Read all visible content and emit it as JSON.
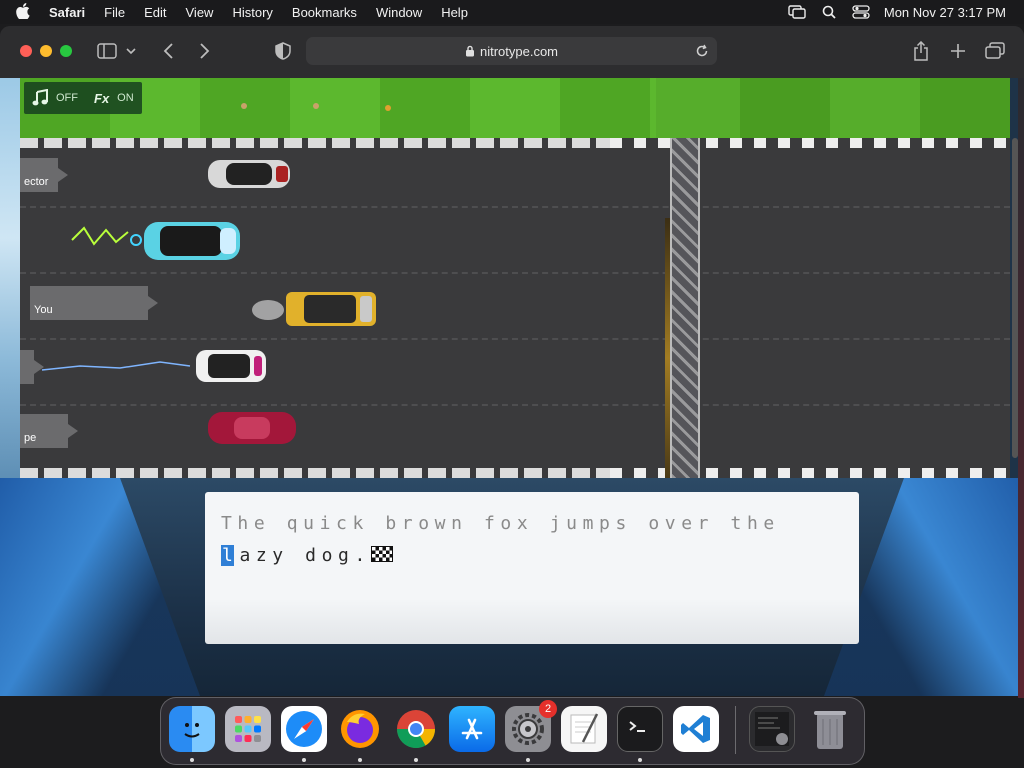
{
  "menubar": {
    "app": "Safari",
    "items": [
      "File",
      "Edit",
      "View",
      "History",
      "Bookmarks",
      "Window",
      "Help"
    ],
    "clock": "Mon Nov 27  3:17 PM"
  },
  "browser": {
    "url": "nitrotype.com"
  },
  "race": {
    "sound": {
      "music_state": "OFF",
      "fx_label": "Fx",
      "fx_state": "ON"
    },
    "racers": [
      {
        "label": "ector"
      },
      {
        "label": ""
      },
      {
        "label": "You"
      },
      {
        "label": ""
      },
      {
        "label": "pe"
      }
    ]
  },
  "typing": {
    "typed": "The quick brown fox jumps over the ",
    "current": "l",
    "remaining": "azy dog."
  },
  "dock": {
    "apps": [
      "finder",
      "launchpad",
      "safari",
      "firefox",
      "chrome",
      "app-store",
      "system-settings",
      "textedit",
      "terminal",
      "vscode"
    ],
    "settings_badge": "2"
  }
}
